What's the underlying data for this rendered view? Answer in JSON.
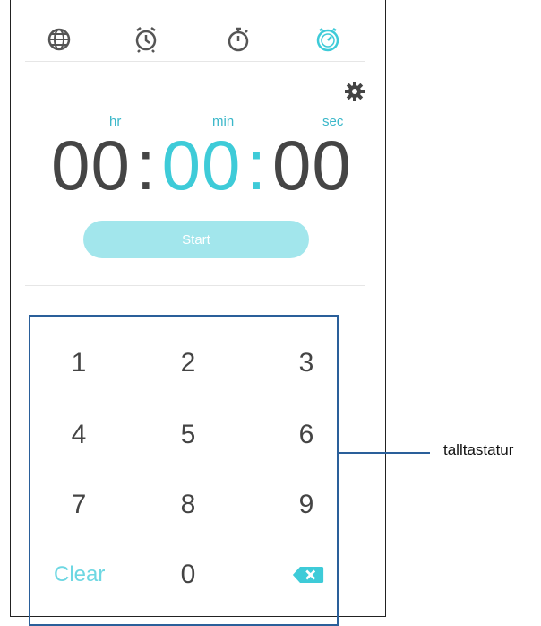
{
  "tabs": [
    {
      "id": "world-clock",
      "icon": "globe-icon"
    },
    {
      "id": "alarm",
      "icon": "alarm-clock-icon"
    },
    {
      "id": "stopwatch",
      "icon": "stopwatch-icon"
    },
    {
      "id": "timer",
      "icon": "timer-icon",
      "active": true
    }
  ],
  "colors": {
    "accent": "#3ecbd8",
    "start_button": "#a2e6ec",
    "clear_text": "#6ed7e2",
    "callout": "#2a5f9a",
    "digits": "#454545"
  },
  "timer": {
    "hr_label": "hr",
    "min_label": "min",
    "sec_label": "sec",
    "hours": "00",
    "minutes": "00",
    "seconds": "00",
    "separator": ":"
  },
  "start_label": "Start",
  "keypad": {
    "k1": "1",
    "k2": "2",
    "k3": "3",
    "k4": "4",
    "k5": "5",
    "k6": "6",
    "k7": "7",
    "k8": "8",
    "k9": "9",
    "clear": "Clear",
    "k0": "0",
    "backspace_icon": "backspace-icon"
  },
  "callout": "talltastatur"
}
